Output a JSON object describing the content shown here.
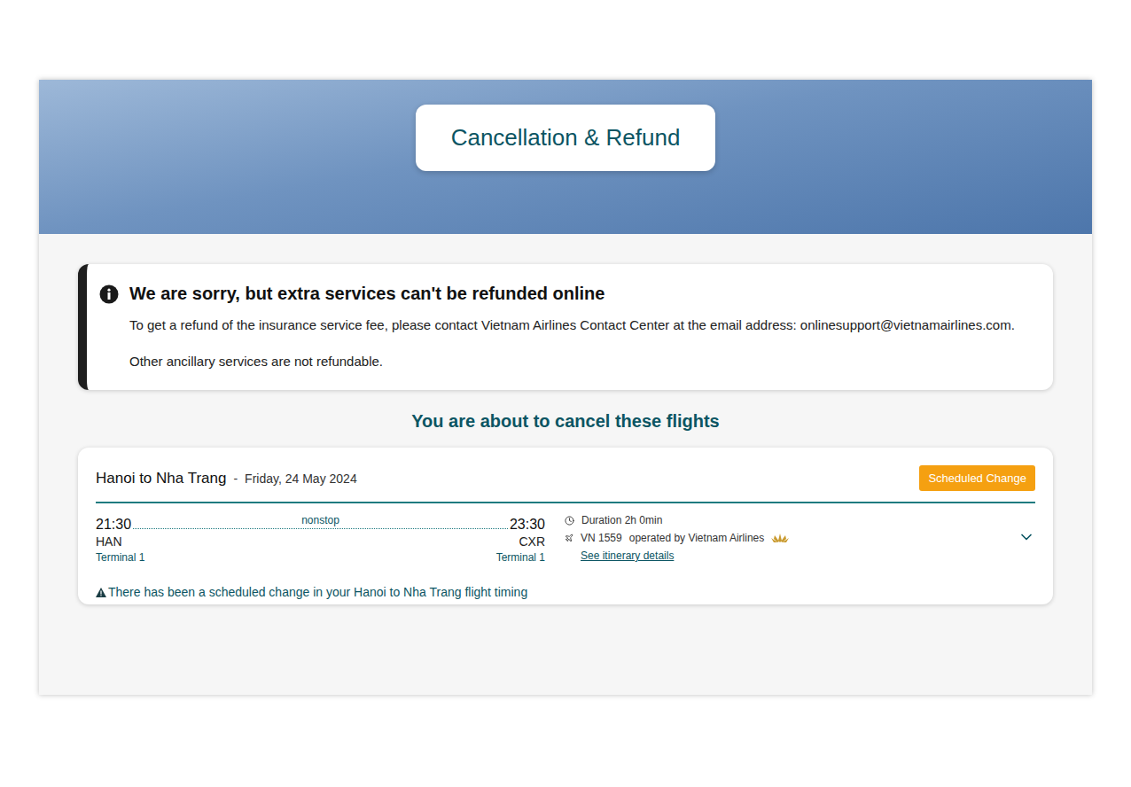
{
  "banner": {
    "title": "Cancellation & Refund"
  },
  "notice": {
    "title": "We are sorry, but extra services can't be refunded online",
    "lines": [
      "To get a refund of the insurance service fee, please contact Vietnam Airlines Contact Center at the email address: onlinesupport@vietnamairlines.com.",
      "Other ancillary services are not refundable."
    ]
  },
  "heading": "You are about to cancel these flights",
  "flights": [
    {
      "route": "Hanoi to Nha Trang",
      "separator": "-",
      "date": "Friday, 24 May 2024",
      "badge": "Scheduled Change",
      "departure": {
        "time": "21:30",
        "code": "HAN",
        "terminal": "Terminal 1"
      },
      "arrival": {
        "time": "23:30",
        "code": "CXR",
        "terminal": "Terminal 1"
      },
      "stops": "nonstop",
      "duration": "Duration 2h 0min",
      "flight_number": "VN 1559",
      "operator": "operated by Vietnam Airlines",
      "details_link": "See itinerary details",
      "expanded": false,
      "warning": "There has been a scheduled change in your Hanoi to Nha Trang flight timing"
    }
  ]
}
